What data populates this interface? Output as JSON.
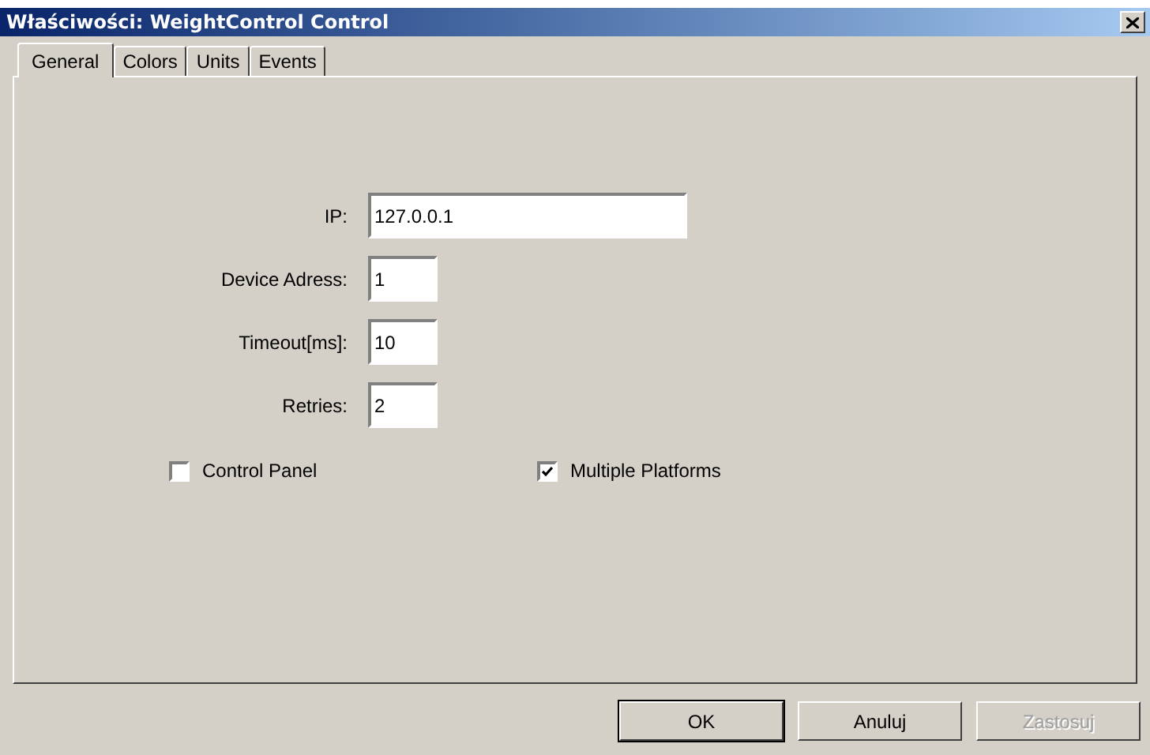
{
  "window": {
    "title": "Właściwości: WeightControl Control"
  },
  "tabs": [
    {
      "label": "General",
      "selected": true
    },
    {
      "label": "Colors",
      "selected": false
    },
    {
      "label": "Units",
      "selected": false
    },
    {
      "label": "Events",
      "selected": false
    }
  ],
  "fields": [
    {
      "label": "IP:",
      "value": "127.0.0.1",
      "kind": "wide"
    },
    {
      "label": "Device Adress:",
      "value": "1",
      "kind": "short"
    },
    {
      "label": "Timeout[ms]:",
      "value": "10",
      "kind": "short"
    },
    {
      "label": "Retries:",
      "value": "2",
      "kind": "short"
    }
  ],
  "checkboxes": [
    {
      "label": "Control Panel",
      "checked": false
    },
    {
      "label": "Multiple Platforms",
      "checked": true
    }
  ],
  "buttons": [
    {
      "label": "OK",
      "default": true,
      "disabled": false
    },
    {
      "label": "Anuluj",
      "default": false,
      "disabled": false
    },
    {
      "label": "Zastosuj",
      "default": false,
      "disabled": true
    }
  ]
}
